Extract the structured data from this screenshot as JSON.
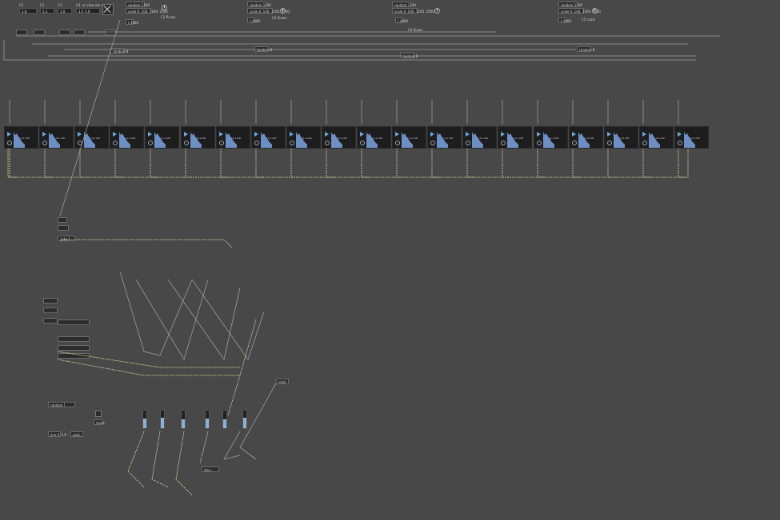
{
  "top_left": {
    "headers": [
      "C1",
      "C2",
      "C3",
      "C4",
      "or view sec outd"
    ],
    "numbers": [
      "1.0",
      "1.1",
      "1.0",
      "1.0",
      "1.0"
    ]
  },
  "groups": [
    {
      "label": "C2 fluxes",
      "obj1": "random 1100",
      "obj2": "scale 0. 100. 1100. 2500.",
      "obj3": "t 4000",
      "obj4": "random 8",
      "dial": "ms dial"
    },
    {
      "label": "C3 fluxes",
      "obj1": "random 1100",
      "obj2": "scale 0. 100. 1100. 2500.",
      "obj3": "t 4000",
      "obj4": "random 8",
      "dial": "ms dial"
    },
    {
      "label": "C4 fluxes",
      "obj1": "random 1100",
      "obj2": "scale 0. 100. 1100. 2500.",
      "obj3": "t 4000",
      "obj4": "random 8",
      "dial": "ms dial"
    },
    {
      "label": "C5 scale",
      "obj1": "random 1100",
      "obj2": "scale 0. 100. 1100. 2500.",
      "obj3": "t 4000",
      "obj4": "random 8",
      "dial": "ms dial"
    }
  ],
  "samplers": [
    "1.1 mtr",
    "2.1 mtr",
    "1.1 mtr",
    "1.1 mtr",
    "1.1 mtr",
    "1.1 mtr",
    "1.1 mtr",
    "1.1 mtr",
    "1.1 mtr",
    "1.1 mtr",
    "1.1 mtr",
    "1.1 mtr",
    "1.1 mtr",
    "1.1 mtr",
    "1.1 mtr",
    "1.1 mtr",
    "1.1 mtr",
    "1.1 mtr",
    "1.1 mtr",
    "1.1 mtr"
  ],
  "bottom_objects": {
    "gate_label": "gate 1",
    "random_label": "random 8",
    "route_label": "route",
    "pack_label": "pack",
    "line_label": "line 0. 1.0",
    "dac_label": "dac~",
    "mtof_label": "mtof",
    "meters": [
      0.55,
      0.6,
      0.5,
      0.55,
      0.5,
      0.6
    ]
  }
}
